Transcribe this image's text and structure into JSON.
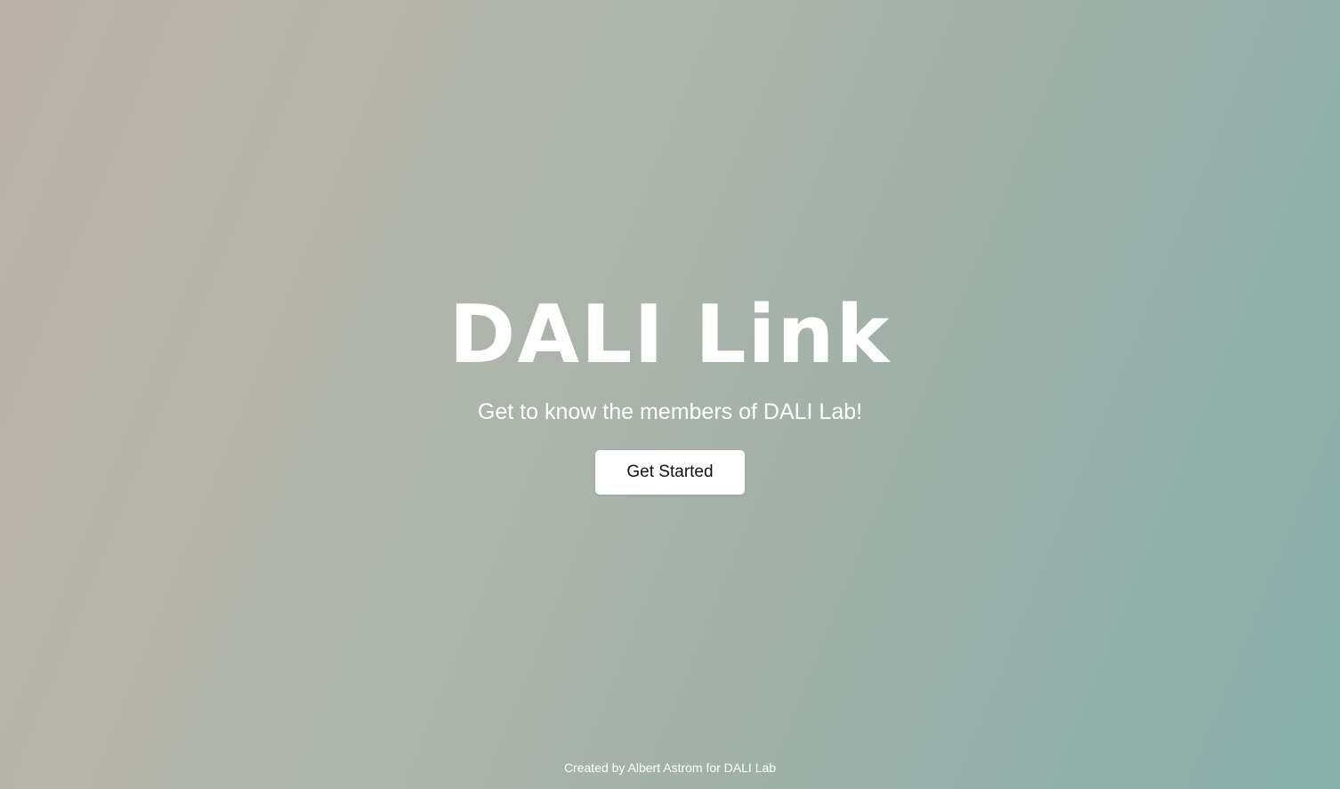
{
  "hero": {
    "title": "DALI Link",
    "subtitle": "Get to know the members of DALI Lab!",
    "cta_label": "Get Started"
  },
  "footer": {
    "credit": "Created by Albert Astrom for DALI Lab"
  },
  "colors": {
    "gradient_start": "#bab2a8",
    "gradient_end": "#86b0a9",
    "text": "#ffffff",
    "button_bg": "#ffffff",
    "button_text": "#111111"
  }
}
